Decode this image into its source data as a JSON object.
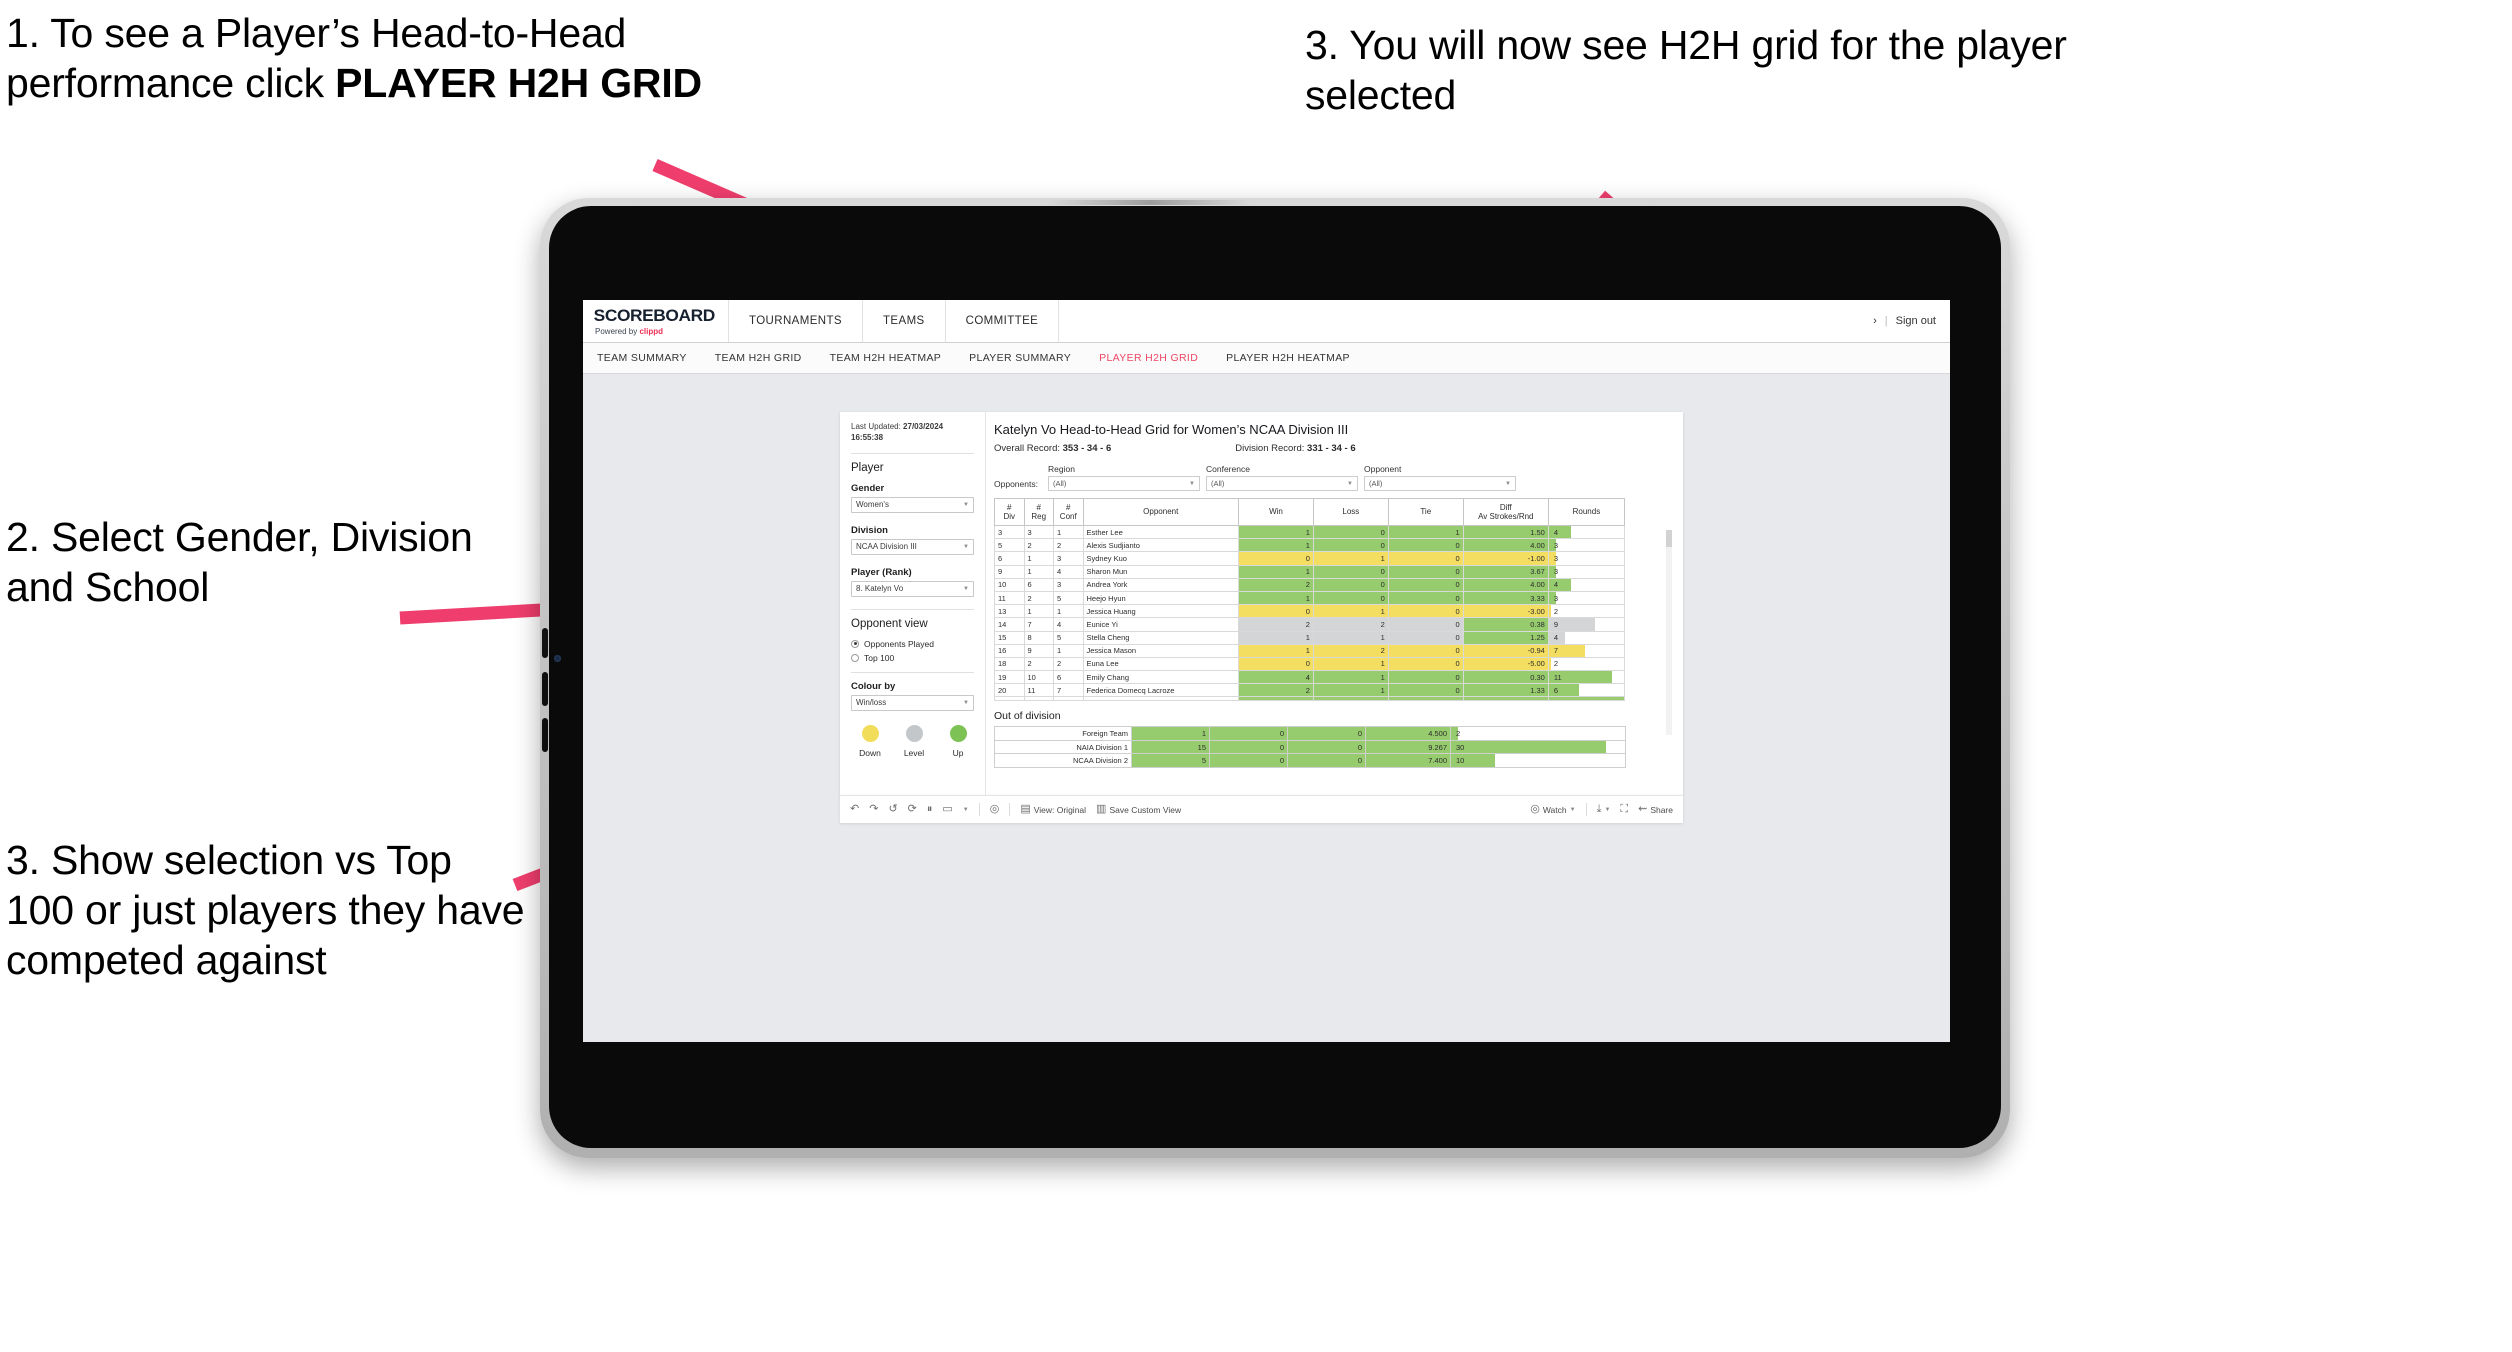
{
  "annotations": [
    {
      "id": "a1",
      "lead": "1. To see a Player’s Head-to-Head performance click ",
      "bold": "PLAYER H2H GRID"
    },
    {
      "id": "a2",
      "text": "2. Select Gender, Division and School"
    },
    {
      "id": "a3",
      "text": "3. Show selection vs Top 100 or just players they have competed against"
    },
    {
      "id": "a4",
      "text": "3. You will now see H2H grid for the player selected"
    }
  ],
  "app": {
    "brand": {
      "title": "SCOREBOARD",
      "powered_prefix": "Powered by ",
      "powered_brand": "clippd"
    },
    "top_nav": [
      "TOURNAMENTS",
      "TEAMS",
      "COMMITTEE"
    ],
    "account": {
      "chevron": "›",
      "separator": "|",
      "sign_out": "Sign out"
    },
    "sub_nav": [
      {
        "label": "TEAM SUMMARY",
        "active": false
      },
      {
        "label": "TEAM H2H GRID",
        "active": false
      },
      {
        "label": "TEAM H2H HEATMAP",
        "active": false
      },
      {
        "label": "PLAYER SUMMARY",
        "active": false
      },
      {
        "label": "PLAYER H2H GRID",
        "active": true
      },
      {
        "label": "PLAYER H2H HEATMAP",
        "active": false
      }
    ]
  },
  "sidebar": {
    "last_updated_label": "Last Updated: ",
    "last_updated_value": "27/03/2024 16:55:38",
    "player_heading": "Player",
    "fields": [
      {
        "label": "Gender",
        "value": "Women's"
      },
      {
        "label": "Division",
        "value": "NCAA Division III"
      },
      {
        "label": "Player (Rank)",
        "value": "8. Katelyn Vo"
      }
    ],
    "opponent_view_heading": "Opponent view",
    "opponent_view_options": [
      {
        "label": "Opponents Played",
        "selected": true
      },
      {
        "label": "Top 100",
        "selected": false
      }
    ],
    "colour_by_label": "Colour by",
    "colour_by_value": "Win/loss",
    "legend": [
      {
        "label": "Down",
        "color": "#f2dd5a"
      },
      {
        "label": "Level",
        "color": "#c4c7c9"
      },
      {
        "label": "Up",
        "color": "#7cc254"
      }
    ]
  },
  "view": {
    "title": "Katelyn Vo Head-to-Head Grid for Women’s NCAA Division III",
    "overall_record_label": "Overall Record: ",
    "overall_record_value": "353 -  34 - 6",
    "division_record_label": "Division Record: ",
    "division_record_value": "331 -  34 - 6",
    "opponents_label": "Opponents:",
    "filters": [
      {
        "caption": "Region",
        "value": "(All)"
      },
      {
        "caption": "Conference",
        "value": "(All)"
      },
      {
        "caption": "Opponent",
        "value": "(All)"
      }
    ]
  },
  "chart_data": {
    "type": "table",
    "title": "Katelyn Vo Head-to-Head Grid for Women’s NCAA Division III",
    "columns": [
      "# Div",
      "# Reg",
      "# Conf",
      "Opponent",
      "Win",
      "Loss",
      "Tie",
      "Diff Av Strokes/Rnd",
      "Rounds"
    ],
    "rows": [
      {
        "div": "3",
        "reg": "3",
        "conf": "1",
        "opponent": "Esther Lee",
        "win": "1",
        "loss": "0",
        "tie": "1",
        "diff": "1.50",
        "rounds": "4",
        "state": "up",
        "rounds_pct": 0.3
      },
      {
        "div": "5",
        "reg": "2",
        "conf": "2",
        "opponent": "Alexis Sudjianto",
        "win": "1",
        "loss": "0",
        "tie": "0",
        "diff": "4.00",
        "rounds": "3",
        "state": "up",
        "rounds_pct": 0.1
      },
      {
        "div": "6",
        "reg": "1",
        "conf": "3",
        "opponent": "Sydney Kuo",
        "win": "0",
        "loss": "1",
        "tie": "0",
        "diff": "-1.00",
        "rounds": "3",
        "state": "down",
        "rounds_pct": 0.1
      },
      {
        "div": "9",
        "reg": "1",
        "conf": "4",
        "opponent": "Sharon Mun",
        "win": "1",
        "loss": "0",
        "tie": "0",
        "diff": "3.67",
        "rounds": "3",
        "state": "up",
        "rounds_pct": 0.1
      },
      {
        "div": "10",
        "reg": "6",
        "conf": "3",
        "opponent": "Andrea York",
        "win": "2",
        "loss": "0",
        "tie": "0",
        "diff": "4.00",
        "rounds": "4",
        "state": "up",
        "rounds_pct": 0.3
      },
      {
        "div": "11",
        "reg": "2",
        "conf": "5",
        "opponent": "Heejo Hyun",
        "win": "1",
        "loss": "0",
        "tie": "0",
        "diff": "3.33",
        "rounds": "3",
        "state": "up",
        "rounds_pct": 0.1
      },
      {
        "div": "13",
        "reg": "1",
        "conf": "1",
        "opponent": "Jessica Huang",
        "win": "0",
        "loss": "1",
        "tie": "0",
        "diff": "-3.00",
        "rounds": "2",
        "state": "down",
        "rounds_pct": 0.03
      },
      {
        "div": "14",
        "reg": "7",
        "conf": "4",
        "opponent": "Eunice Yi",
        "win": "2",
        "loss": "2",
        "tie": "0",
        "diff": "0.38",
        "rounds": "9",
        "state": "level",
        "diff_state": "up",
        "rounds_pct": 0.62
      },
      {
        "div": "15",
        "reg": "8",
        "conf": "5",
        "opponent": "Stella Cheng",
        "win": "1",
        "loss": "1",
        "tie": "0",
        "diff": "1.25",
        "rounds": "4",
        "state": "level",
        "diff_state": "up",
        "rounds_pct": 0.21
      },
      {
        "div": "16",
        "reg": "9",
        "conf": "1",
        "opponent": "Jessica Mason",
        "win": "1",
        "loss": "2",
        "tie": "0",
        "diff": "-0.94",
        "rounds": "7",
        "state": "down",
        "rounds_pct": 0.48
      },
      {
        "div": "18",
        "reg": "2",
        "conf": "2",
        "opponent": "Euna Lee",
        "win": "0",
        "loss": "1",
        "tie": "0",
        "diff": "-5.00",
        "rounds": "2",
        "state": "down",
        "rounds_pct": 0.03
      },
      {
        "div": "19",
        "reg": "10",
        "conf": "6",
        "opponent": "Emily Chang",
        "win": "4",
        "loss": "1",
        "tie": "0",
        "diff": "0.30",
        "rounds": "11",
        "state": "up",
        "rounds_pct": 0.84
      },
      {
        "div": "20",
        "reg": "11",
        "conf": "7",
        "opponent": "Federica Domecq Lacroze",
        "win": "2",
        "loss": "1",
        "tie": "0",
        "diff": "1.33",
        "rounds": "6",
        "state": "up",
        "rounds_pct": 0.4
      }
    ],
    "out_of_division_title": "Out of division",
    "out_of_division": [
      {
        "opponent": "Foreign Team",
        "win": "1",
        "loss": "0",
        "tie": "0",
        "diff": "4.500",
        "rounds": "2",
        "state": "up",
        "rounds_pct": 0.04
      },
      {
        "opponent": "NAIA Division 1",
        "win": "15",
        "loss": "0",
        "tie": "0",
        "diff": "9.267",
        "rounds": "30",
        "state": "up",
        "rounds_pct": 0.89
      },
      {
        "opponent": "NCAA Division 2",
        "win": "5",
        "loss": "0",
        "tie": "0",
        "diff": "7.400",
        "rounds": "10",
        "state": "up",
        "rounds_pct": 0.25
      }
    ],
    "colors": {
      "up": "#97cc6e",
      "down": "#f4de61",
      "level": "#d3d5d6"
    }
  },
  "toolbar": {
    "undo": "↶",
    "redo": "↷",
    "revert": "↺",
    "refresh": "⟳",
    "pause": "⏸",
    "device": "▭",
    "dropdown": "▾",
    "view_label": "View: Original",
    "save_label": "Save Custom View",
    "watch_label": "Watch",
    "share_label": "Share"
  }
}
